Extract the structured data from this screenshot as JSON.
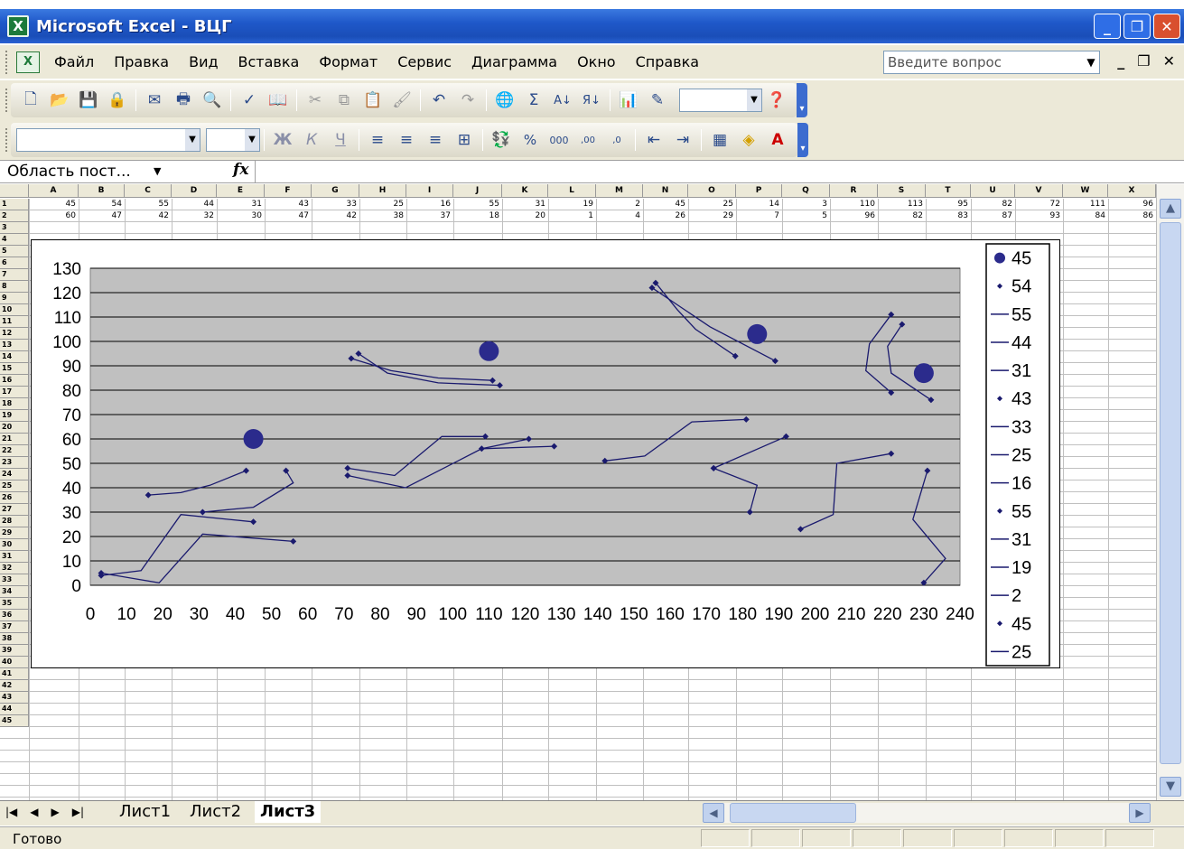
{
  "window": {
    "title": "Microsoft Excel - ВЦГ",
    "app_icon": "X"
  },
  "menu": {
    "items": [
      "Файл",
      "Правка",
      "Вид",
      "Вставка",
      "Формат",
      "Сервис",
      "Диаграмма",
      "Окно",
      "Справка"
    ],
    "help_placeholder": "Введите вопрос"
  },
  "formula_bar": {
    "name_box": "Область пост...",
    "fx": "fx"
  },
  "grid": {
    "columns": [
      "A",
      "B",
      "C",
      "D",
      "E",
      "F",
      "G",
      "H",
      "I",
      "J",
      "K",
      "L",
      "M",
      "N",
      "O",
      "P",
      "Q",
      "R",
      "S",
      "T",
      "U",
      "V",
      "W",
      "X"
    ],
    "row1": [
      "45",
      "54",
      "55",
      "44",
      "31",
      "43",
      "33",
      "25",
      "16",
      "55",
      "31",
      "19",
      "2",
      "45",
      "25",
      "14",
      "3",
      "110",
      "113",
      "95",
      "82",
      "72",
      "111",
      "96"
    ],
    "row2": [
      "60",
      "47",
      "42",
      "32",
      "30",
      "47",
      "42",
      "38",
      "37",
      "18",
      "20",
      "1",
      "4",
      "26",
      "29",
      "7",
      "5",
      "96",
      "82",
      "83",
      "87",
      "93",
      "84",
      "86"
    ],
    "row_numbers": [
      "1",
      "2",
      "3",
      "4",
      "5",
      "6",
      "7",
      "8",
      "9",
      "10",
      "11",
      "12",
      "13",
      "14",
      "15",
      "16",
      "17",
      "18",
      "19",
      "20",
      "21",
      "22",
      "23",
      "24",
      "25",
      "26",
      "27",
      "28",
      "29",
      "30",
      "31",
      "32",
      "33",
      "34",
      "35",
      "36",
      "37",
      "38",
      "39",
      "40",
      "41",
      "42",
      "43",
      "44",
      "45"
    ]
  },
  "chart_data": {
    "type": "scatter",
    "xlim": [
      0,
      240
    ],
    "ylim": [
      0,
      130
    ],
    "x_ticks": [
      "0",
      "10",
      "20",
      "30",
      "40",
      "50",
      "60",
      "70",
      "80",
      "90",
      "100",
      "110",
      "120",
      "130",
      "140",
      "150",
      "160",
      "170",
      "180",
      "190",
      "200",
      "210",
      "220",
      "230",
      "240"
    ],
    "y_ticks": [
      "0",
      "10",
      "20",
      "30",
      "40",
      "50",
      "60",
      "70",
      "80",
      "90",
      "100",
      "110",
      "120",
      "130"
    ],
    "grid": true,
    "legend_position": "right",
    "big_points": [
      [
        45,
        60
      ],
      [
        110,
        96
      ],
      [
        184,
        103
      ],
      [
        230,
        87
      ]
    ],
    "segments": [
      [
        [
          3,
          4
        ],
        [
          14,
          6
        ],
        [
          25,
          29
        ],
        [
          45,
          26
        ]
      ],
      [
        [
          3,
          5
        ],
        [
          19,
          1
        ],
        [
          31,
          21
        ],
        [
          56,
          18
        ]
      ],
      [
        [
          16,
          37
        ],
        [
          25,
          38
        ],
        [
          33,
          41
        ],
        [
          43,
          47
        ]
      ],
      [
        [
          31,
          30
        ],
        [
          45,
          32
        ],
        [
          56,
          42
        ],
        [
          54,
          47
        ]
      ],
      [
        [
          72,
          93
        ],
        [
          83,
          88
        ],
        [
          96,
          85
        ],
        [
          111,
          84
        ]
      ],
      [
        [
          74,
          95
        ],
        [
          82,
          87
        ],
        [
          96,
          83
        ],
        [
          113,
          82
        ]
      ],
      [
        [
          71,
          48
        ],
        [
          84,
          45
        ],
        [
          97,
          61
        ],
        [
          109,
          61
        ]
      ],
      [
        [
          71,
          45
        ],
        [
          87,
          40
        ],
        [
          108,
          56
        ],
        [
          121,
          60
        ]
      ],
      [
        [
          108,
          56
        ],
        [
          128,
          57
        ]
      ],
      [
        [
          142,
          51
        ],
        [
          153,
          53
        ],
        [
          166,
          67
        ],
        [
          181,
          68
        ]
      ],
      [
        [
          155,
          122
        ],
        [
          162,
          115
        ],
        [
          171,
          106
        ],
        [
          189,
          92
        ]
      ],
      [
        [
          156,
          124
        ],
        [
          162,
          113
        ],
        [
          167,
          105
        ],
        [
          178,
          94
        ]
      ],
      [
        [
          172,
          48
        ],
        [
          192,
          61
        ]
      ],
      [
        [
          172,
          48
        ],
        [
          184,
          41
        ],
        [
          182,
          30
        ]
      ],
      [
        [
          196,
          23
        ],
        [
          205,
          29
        ],
        [
          206,
          50
        ],
        [
          221,
          54
        ]
      ],
      [
        [
          221,
          111
        ],
        [
          215,
          99
        ],
        [
          214,
          88
        ],
        [
          221,
          79
        ]
      ],
      [
        [
          224,
          107
        ],
        [
          220,
          98
        ],
        [
          221,
          87
        ],
        [
          232,
          76
        ]
      ],
      [
        [
          231,
          47
        ],
        [
          227,
          27
        ],
        [
          236,
          11
        ],
        [
          230,
          1
        ]
      ]
    ],
    "legend": [
      "45",
      "54",
      "55",
      "44",
      "31",
      "43",
      "33",
      "25",
      "16",
      "55",
      "31",
      "19",
      "2",
      "45",
      "25"
    ],
    "legend_markers": [
      "dot",
      "diamond",
      "line",
      "line",
      "line",
      "diamond",
      "line",
      "line",
      "line",
      "diamond",
      "line",
      "line",
      "line",
      "diamond",
      "line"
    ]
  },
  "sheets": {
    "tabs": [
      "Лист1",
      "Лист2",
      "Лист3"
    ],
    "active": "Лист3"
  },
  "status": {
    "text": "Готово"
  },
  "colors": {
    "series": "#1a1a6e",
    "plot_bg": "#c0c0c0",
    "title_bar": "#1f58c9"
  }
}
